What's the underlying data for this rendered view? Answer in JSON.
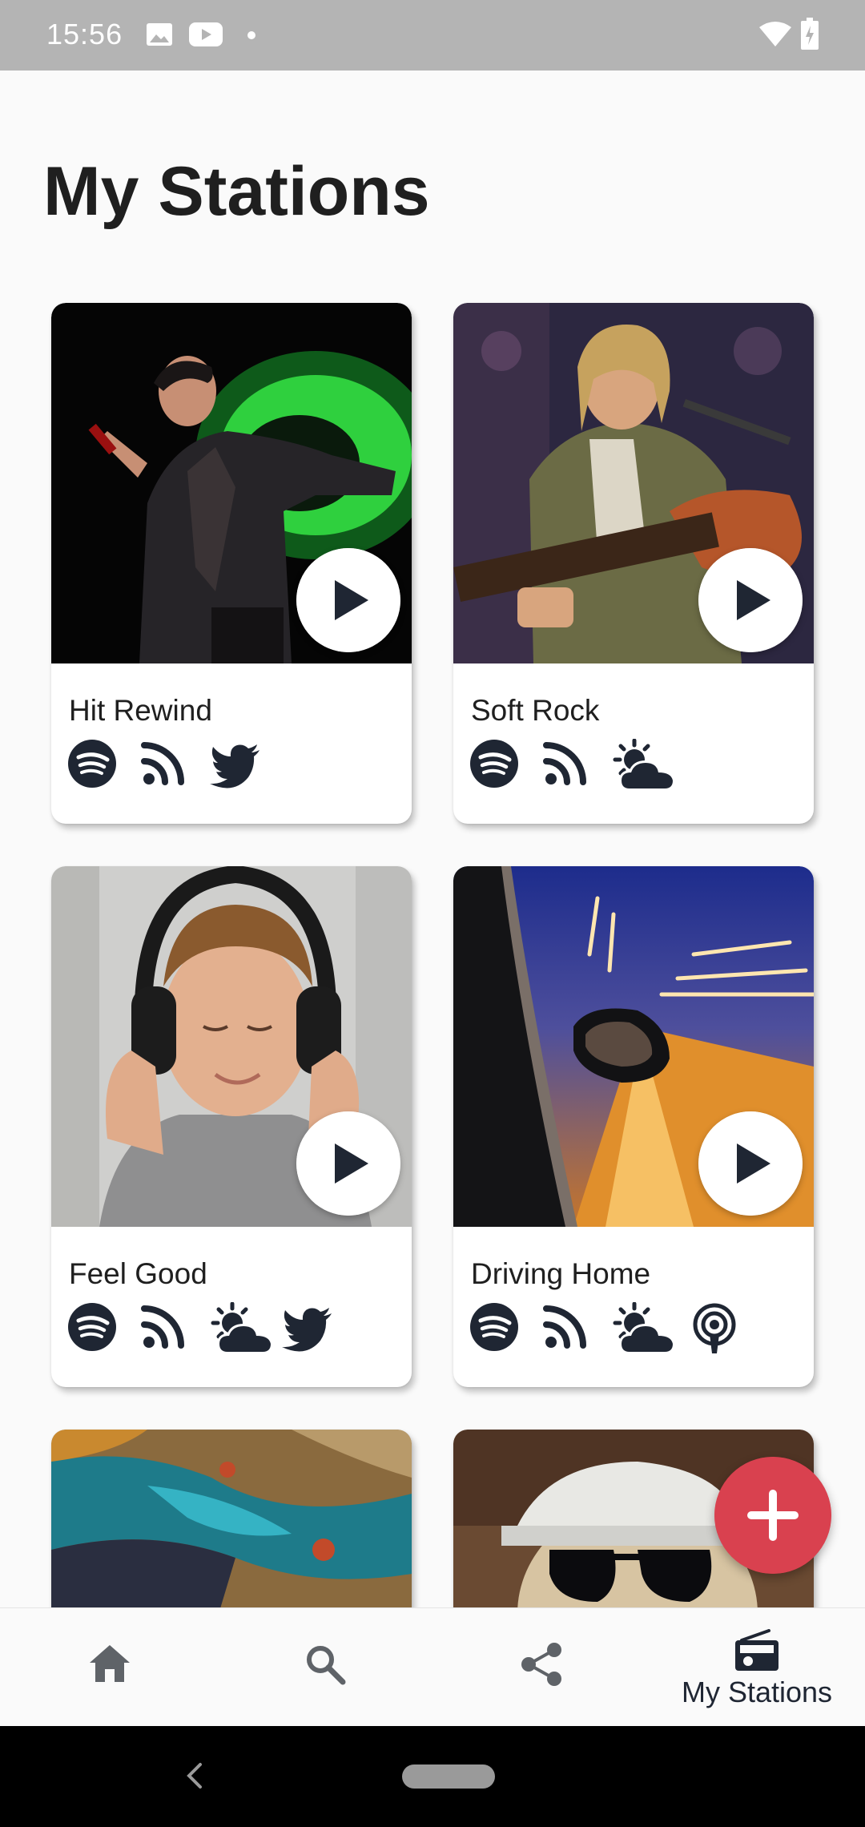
{
  "status_bar": {
    "time": "15:56",
    "icons": [
      "image-icon",
      "youtube-icon",
      "notification-dot-icon",
      "wifi-icon",
      "battery-charging-icon"
    ]
  },
  "page": {
    "title": "My Stations"
  },
  "stations": [
    {
      "name": "Hit Rewind",
      "image": "singer-with-microphone-photo",
      "sources": [
        "spotify-icon",
        "rss-icon",
        "twitter-icon"
      ]
    },
    {
      "name": "Soft Rock",
      "image": "guitarist-singing-photo",
      "sources": [
        "spotify-icon",
        "rss-icon",
        "weather-icon"
      ]
    },
    {
      "name": "Feel Good",
      "image": "child-with-headphones-photo",
      "sources": [
        "spotify-icon",
        "rss-icon",
        "weather-icon",
        "twitter-icon"
      ]
    },
    {
      "name": "Driving Home",
      "image": "car-at-night-photo",
      "sources": [
        "spotify-icon",
        "rss-icon",
        "weather-icon",
        "podcast-icon"
      ]
    },
    {
      "name": "",
      "image": "aerial-coastline-photo",
      "sources": []
    },
    {
      "name": "",
      "image": "dog-with-sunglasses-photo",
      "sources": []
    }
  ],
  "fab": {
    "icon": "add-icon"
  },
  "bottom_nav": {
    "items": [
      {
        "icon": "home-icon",
        "label": ""
      },
      {
        "icon": "search-icon",
        "label": ""
      },
      {
        "icon": "share-icon",
        "label": ""
      },
      {
        "icon": "radio-icon",
        "label": "My Stations",
        "active": true
      }
    ]
  },
  "colors": {
    "accent": "#d9414f",
    "icon_dark": "#1f2633",
    "background": "#fafafa",
    "status_bar": "#b4b4b4"
  }
}
